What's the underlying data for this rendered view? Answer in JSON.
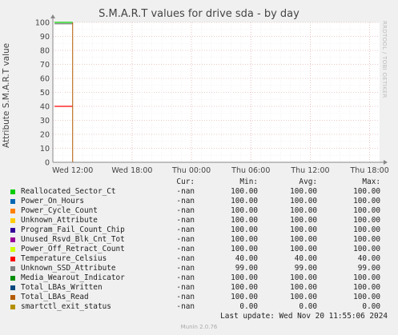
{
  "title": "S.M.A.R.T values for drive sda - by day",
  "rrdtool_label": "RRDTOOL / TOBI OETIKER",
  "footer": "Munin 2.0.76",
  "last_update": "Last update: Wed Nov 20 11:55:06 2024",
  "legend_headers": {
    "cur": "Cur:",
    "min": "Min:",
    "avg": "Avg:",
    "max": "Max:"
  },
  "legend": [
    {
      "name": "Reallocated_Sector_Ct",
      "color": "#00cc00",
      "cur": "-nan",
      "min": "100.00",
      "avg": "100.00",
      "max": "100.00"
    },
    {
      "name": "Power_On_Hours",
      "color": "#0066b3",
      "cur": "-nan",
      "min": "100.00",
      "avg": "100.00",
      "max": "100.00"
    },
    {
      "name": "Power_Cycle_Count",
      "color": "#ff8000",
      "cur": "-nan",
      "min": "100.00",
      "avg": "100.00",
      "max": "100.00"
    },
    {
      "name": "Unknown_Attribute",
      "color": "#ffcc00",
      "cur": "-nan",
      "min": "100.00",
      "avg": "100.00",
      "max": "100.00"
    },
    {
      "name": "Program_Fail_Count_Chip",
      "color": "#330099",
      "cur": "-nan",
      "min": "100.00",
      "avg": "100.00",
      "max": "100.00"
    },
    {
      "name": "Unused_Rsvd_Blk_Cnt_Tot",
      "color": "#990099",
      "cur": "-nan",
      "min": "100.00",
      "avg": "100.00",
      "max": "100.00"
    },
    {
      "name": "Power_Off_Retract_Count",
      "color": "#ccff00",
      "cur": "-nan",
      "min": "100.00",
      "avg": "100.00",
      "max": "100.00"
    },
    {
      "name": "Temperature_Celsius",
      "color": "#ff0000",
      "cur": "-nan",
      "min": "40.00",
      "avg": "40.00",
      "max": "40.00"
    },
    {
      "name": "Unknown_SSD_Attribute",
      "color": "#808080",
      "cur": "-nan",
      "min": "99.00",
      "avg": "99.00",
      "max": "99.00"
    },
    {
      "name": "Media_Wearout_Indicator",
      "color": "#008f00",
      "cur": "-nan",
      "min": "100.00",
      "avg": "100.00",
      "max": "100.00"
    },
    {
      "name": "Total_LBAs_Written",
      "color": "#00487d",
      "cur": "-nan",
      "min": "100.00",
      "avg": "100.00",
      "max": "100.00"
    },
    {
      "name": "Total_LBAs_Read",
      "color": "#b35a00",
      "cur": "-nan",
      "min": "100.00",
      "avg": "100.00",
      "max": "100.00"
    },
    {
      "name": "smartctl_exit_status",
      "color": "#b38f00",
      "cur": "-nan",
      "min": "0.00",
      "avg": "0.00",
      "max": "0.00"
    }
  ],
  "chart_data": {
    "type": "line",
    "title": "S.M.A.R.T values for drive sda - by day",
    "ylabel": "Attribute S.M.A.R.T value",
    "xlabel": "",
    "ylim": [
      0,
      100
    ],
    "yticks": [
      0,
      10,
      20,
      30,
      40,
      50,
      60,
      70,
      80,
      90,
      100
    ],
    "xlim": [
      "Wed 10:00",
      "Thu 19:00"
    ],
    "xticks": [
      "Wed 12:00",
      "Wed 18:00",
      "Thu 00:00",
      "Thu 06:00",
      "Thu 12:00",
      "Thu 18:00"
    ],
    "grid": true,
    "series": [
      {
        "name": "Reallocated_Sector_Ct",
        "x": [
          "Wed 10:10",
          "Wed 12:00"
        ],
        "values": [
          100,
          100
        ]
      },
      {
        "name": "Temperature_Celsius",
        "x": [
          "Wed 10:10",
          "Wed 12:00"
        ],
        "values": [
          40,
          40
        ]
      },
      {
        "name": "Unknown_SSD_Attribute",
        "x": [
          "Wed 10:10",
          "Wed 12:00"
        ],
        "values": [
          99,
          99
        ]
      },
      {
        "name": "smartctl_exit_status",
        "x": [
          "Wed 10:10",
          "Thu 19:00"
        ],
        "values": [
          0,
          0
        ]
      }
    ]
  }
}
